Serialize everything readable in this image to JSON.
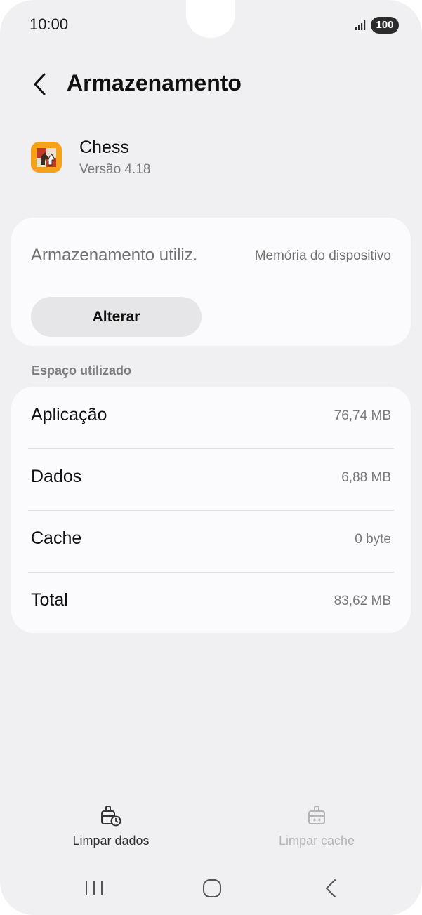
{
  "status_bar": {
    "time": "10:00",
    "battery": "100",
    "signal_icon": "signal-icon"
  },
  "header": {
    "back_icon": "chevron-left-icon",
    "title": "Armazenamento"
  },
  "app": {
    "name": "Chess",
    "version": "Versão 4.18",
    "icon": "chess-app-icon",
    "icon_color": "#f5a21a"
  },
  "storage_location": {
    "label": "Armazenamento utiliz.",
    "value": "Memória do dispositivo",
    "button_label": "Alterar"
  },
  "usage": {
    "section_title": "Espaço utilizado",
    "rows": [
      {
        "label": "Aplicação",
        "value": "76,74 MB"
      },
      {
        "label": "Dados",
        "value": "6,88 MB"
      },
      {
        "label": "Cache",
        "value": "0 byte"
      },
      {
        "label": "Total",
        "value": "83,62 MB"
      }
    ]
  },
  "actions": {
    "clear_data": {
      "label": "Limpar dados",
      "icon": "clear-data-icon",
      "enabled": true
    },
    "clear_cache": {
      "label": "Limpar cache",
      "icon": "clear-cache-icon",
      "enabled": false
    }
  },
  "nav_bar": {
    "recents_icon": "recents-icon",
    "home_icon": "home-icon",
    "back_icon": "back-nav-icon"
  }
}
